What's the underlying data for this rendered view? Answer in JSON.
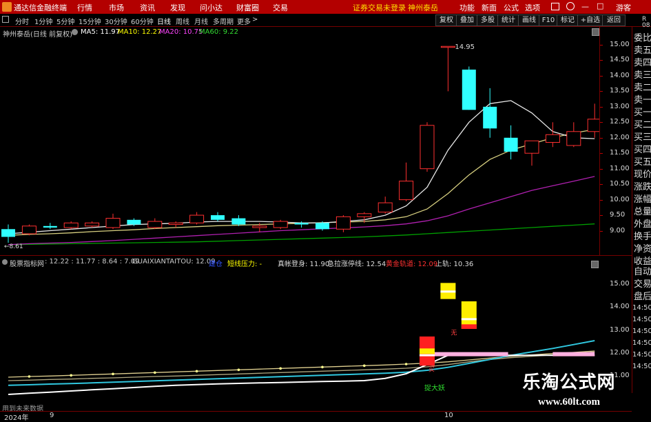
{
  "app": {
    "title": "通达信金融终端",
    "menu": [
      "行情",
      "市场",
      "资讯",
      "发现",
      "问小达",
      "财富圈",
      "交易"
    ],
    "notice": "证券交易未登录",
    "notice_stock": "神州泰岳",
    "right_menu": [
      "功能",
      "新面",
      "公式",
      "选项"
    ],
    "user": "游客"
  },
  "periods": {
    "items": [
      "分时",
      "1分钟",
      "5分钟",
      "15分钟",
      "30分钟",
      "60分钟",
      "日线",
      "周线",
      "月线",
      "多周期",
      "更多"
    ],
    "selected": "日线"
  },
  "tools": [
    "复权",
    "叠加",
    "多股",
    "统计",
    "画线",
    "F10",
    "标记",
    "+自选",
    "返回"
  ],
  "main_header": {
    "stock": "神州泰岳(日线 前复权)",
    "ma5": "MA5: 11.97",
    "ma10": "MA10: 12.27",
    "ma20": "MA20: 10.75",
    "ma60": "MA60: 9.22",
    "colors": {
      "ma5": "#ffffff",
      "ma10": "#ffff00",
      "ma20": "#ff00ff",
      "ma60": "#00ff00"
    }
  },
  "main_axis": [
    "15.00",
    "14.50",
    "14.00",
    "13.50",
    "13.00",
    "12.50",
    "12.00",
    "11.50",
    "11.00",
    "10.50",
    "10.00",
    "9.50",
    "9.00"
  ],
  "annotations": {
    "high": "14.95",
    "low": "8.61"
  },
  "right_panel": [
    "委比",
    "卖五",
    "卖四",
    "卖三",
    "卖二",
    "卖一",
    "买一",
    "买二",
    "买三",
    "买四",
    "买五",
    "现价",
    "涨跌",
    "涨幅",
    "总量",
    "外盘",
    "换手",
    "净资",
    "收益"
  ],
  "right_corner": "R\n08",
  "sub_header": {
    "name": "股票指标网",
    "vals": ": 12.22 : 11.77 : 8.64 : 7.09",
    "gx": "GUAIXIANTAITOU: 12.09",
    "item1": "建仓",
    "item2": "短线压力: -",
    "item3": "真帐登身: 11.90",
    "item4": "急拉涨停线: 12.54",
    "item5": "黄金轨道: 12.09",
    "item6": "上轨: 10.36"
  },
  "sub_axis": [
    "15.00",
    "14.00",
    "13.00",
    "12.00",
    "11.00"
  ],
  "sub_right_panel": [
    "自动",
    "交易",
    "盘后"
  ],
  "sub_right_times": [
    "14:50",
    "14:50",
    "14:50",
    "14:50",
    "14:50",
    "14:50"
  ],
  "sub_labels": {
    "up": "无",
    "catch": "捉大妖",
    "low": "买"
  },
  "footer": {
    "note": "用到未来数据",
    "year": "2024年",
    "m9": "9",
    "m10": "10"
  },
  "watermark": {
    "title": "乐淘公式网",
    "url": "www.60lt.com"
  },
  "chart_data": [
    {
      "type": "candlestick",
      "title": "神州泰岳(日线 前复权)",
      "ylim": [
        8.5,
        15.2
      ],
      "candles": [
        {
          "o": 9.05,
          "h": 9.2,
          "l": 8.61,
          "c": 8.8
        },
        {
          "o": 8.9,
          "h": 9.2,
          "l": 8.85,
          "c": 9.15
        },
        {
          "o": 9.15,
          "h": 9.25,
          "l": 9.05,
          "c": 9.1
        },
        {
          "o": 9.1,
          "h": 9.3,
          "l": 9.05,
          "c": 9.25
        },
        {
          "o": 9.15,
          "h": 9.3,
          "l": 9.1,
          "c": 9.25
        },
        {
          "o": 9.1,
          "h": 9.55,
          "l": 9.05,
          "c": 9.4
        },
        {
          "o": 9.35,
          "h": 9.4,
          "l": 9.15,
          "c": 9.2
        },
        {
          "o": 9.1,
          "h": 9.4,
          "l": 9.05,
          "c": 9.3
        },
        {
          "o": 9.2,
          "h": 9.3,
          "l": 9.1,
          "c": 9.25
        },
        {
          "o": 9.25,
          "h": 9.6,
          "l": 9.2,
          "c": 9.5
        },
        {
          "o": 9.5,
          "h": 9.6,
          "l": 9.3,
          "c": 9.35
        },
        {
          "o": 9.4,
          "h": 9.5,
          "l": 9.15,
          "c": 9.2
        },
        {
          "o": 9.1,
          "h": 9.25,
          "l": 8.95,
          "c": 9.15
        },
        {
          "o": 9.1,
          "h": 9.35,
          "l": 9.05,
          "c": 9.3
        },
        {
          "o": 9.25,
          "h": 9.3,
          "l": 9.1,
          "c": 9.2
        },
        {
          "o": 9.25,
          "h": 9.3,
          "l": 9.0,
          "c": 9.05
        },
        {
          "o": 9.05,
          "h": 9.5,
          "l": 8.95,
          "c": 9.45
        },
        {
          "o": 9.45,
          "h": 9.6,
          "l": 9.25,
          "c": 9.55
        },
        {
          "o": 9.6,
          "h": 10.1,
          "l": 9.55,
          "c": 9.9
        },
        {
          "o": 10.0,
          "h": 11.2,
          "l": 9.95,
          "c": 10.6
        },
        {
          "o": 11.0,
          "h": 12.5,
          "l": 10.9,
          "c": 12.4
        },
        {
          "o": 14.95,
          "h": 14.95,
          "l": 13.5,
          "c": 14.95
        },
        {
          "o": 14.2,
          "h": 14.3,
          "l": 12.9,
          "c": 12.9
        },
        {
          "o": 13.0,
          "h": 13.6,
          "l": 12.0,
          "c": 12.3
        },
        {
          "o": 12.0,
          "h": 12.4,
          "l": 11.3,
          "c": 11.55
        },
        {
          "o": 11.5,
          "h": 11.9,
          "l": 11.1,
          "c": 11.9
        },
        {
          "o": 11.85,
          "h": 12.5,
          "l": 11.7,
          "c": 12.1
        },
        {
          "o": 11.75,
          "h": 12.5,
          "l": 11.7,
          "c": 12.2
        },
        {
          "o": 12.2,
          "h": 13.1,
          "l": 12.0,
          "c": 12.6
        }
      ],
      "ma5": [
        8.9,
        8.95,
        9.0,
        9.05,
        9.1,
        9.15,
        9.2,
        9.22,
        9.24,
        9.28,
        9.3,
        9.3,
        9.3,
        9.28,
        9.25,
        9.25,
        9.3,
        9.35,
        9.5,
        9.8,
        10.4,
        11.6,
        12.5,
        13.1,
        13.2,
        12.8,
        12.2,
        12.0,
        11.97
      ],
      "ma10": [
        8.85,
        8.88,
        8.9,
        8.93,
        8.97,
        9.0,
        9.03,
        9.07,
        9.1,
        9.13,
        9.16,
        9.18,
        9.2,
        9.22,
        9.24,
        9.26,
        9.28,
        9.3,
        9.35,
        9.45,
        9.7,
        10.2,
        10.8,
        11.3,
        11.6,
        11.8,
        12.0,
        12.15,
        12.27
      ],
      "ma20": [
        8.55,
        8.58,
        8.6,
        8.62,
        8.65,
        8.68,
        8.72,
        8.76,
        8.8,
        8.84,
        8.88,
        8.92,
        8.96,
        9.0,
        9.03,
        9.06,
        9.09,
        9.12,
        9.16,
        9.22,
        9.32,
        9.48,
        9.7,
        9.9,
        10.1,
        10.3,
        10.45,
        10.6,
        10.75
      ],
      "ma60": [
        8.55,
        8.56,
        8.57,
        8.58,
        8.59,
        8.6,
        8.61,
        8.62,
        8.63,
        8.64,
        8.66,
        8.68,
        8.7,
        8.72,
        8.74,
        8.76,
        8.78,
        8.8,
        8.83,
        8.86,
        8.9,
        8.94,
        8.98,
        9.02,
        9.06,
        9.1,
        9.14,
        9.18,
        9.22
      ]
    },
    {
      "type": "line",
      "title": "股票指标网",
      "ylim": [
        10.8,
        15.6
      ],
      "series": [
        {
          "name": "上轨",
          "values": [
            10.95,
            10.98,
            11.0,
            11.03,
            11.06,
            11.09,
            11.12,
            11.15,
            11.18,
            11.21,
            11.24,
            11.27,
            11.3,
            11.33,
            11.36,
            11.39,
            11.42,
            11.45,
            11.48,
            11.52,
            11.56,
            11.62,
            11.7,
            11.78,
            11.86,
            11.92,
            11.98,
            12.03,
            12.09
          ]
        },
        {
          "name": "黄金轨道",
          "values": [
            10.8,
            10.82,
            10.85,
            10.87,
            10.9,
            10.92,
            10.95,
            10.98,
            11.0,
            11.03,
            11.06,
            11.09,
            11.12,
            11.15,
            11.18,
            11.21,
            11.24,
            11.27,
            11.3,
            11.34,
            11.4,
            11.5,
            11.62,
            11.72,
            11.8,
            11.86,
            11.92,
            11.98,
            12.05
          ]
        },
        {
          "name": "急拉涨停线",
          "values": [
            10.6,
            10.62,
            10.65,
            10.67,
            10.7,
            10.73,
            10.76,
            10.79,
            10.82,
            10.85,
            10.88,
            10.91,
            10.94,
            10.97,
            11.0,
            11.03,
            11.06,
            11.09,
            11.12,
            11.17,
            11.25,
            11.38,
            11.55,
            11.72,
            11.9,
            12.05,
            12.2,
            12.37,
            12.54
          ]
        },
        {
          "name": "真帐登身",
          "values": [
            10.2,
            10.25,
            10.3,
            10.35,
            10.4,
            10.45,
            10.5,
            10.55,
            10.6,
            10.63,
            10.66,
            10.68,
            10.7,
            10.72,
            10.74,
            10.76,
            10.78,
            10.8,
            10.9,
            11.1,
            11.5,
            11.9,
            11.9,
            11.9,
            11.9,
            11.9,
            11.9,
            11.9,
            11.9
          ]
        }
      ]
    }
  ]
}
